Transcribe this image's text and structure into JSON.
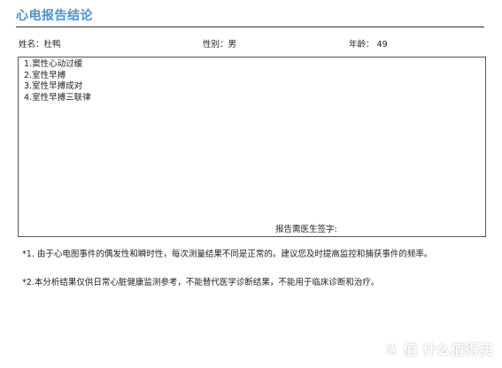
{
  "report": {
    "title": "心电报告结论",
    "title_color": "#4a90d9"
  },
  "patient": {
    "name_label": "姓名：杜鸭",
    "gender_label": "性别：男",
    "age_label": "年龄： 49"
  },
  "conclusions": [
    "1.窦性心动过缓",
    "2.室性早搏",
    "3.室性早搏成对",
    "4.室性早搏三联律"
  ],
  "signature_label": "报告需医生签字:",
  "notes": {
    "note_1": "*1. 由于心电图事件的偶发性和瞬时性，每次测量结果不同是正常的。建议您及时提高监控和捕获事件的频率。",
    "note_2": "*2.本分析结果仅供日常心脏健康监测参考，不能替代医学诊断结果，不能用于临床诊断和治疗。"
  },
  "watermark": {
    "text": "值 什么值得买",
    "icon": "watermark-logo-icon"
  }
}
